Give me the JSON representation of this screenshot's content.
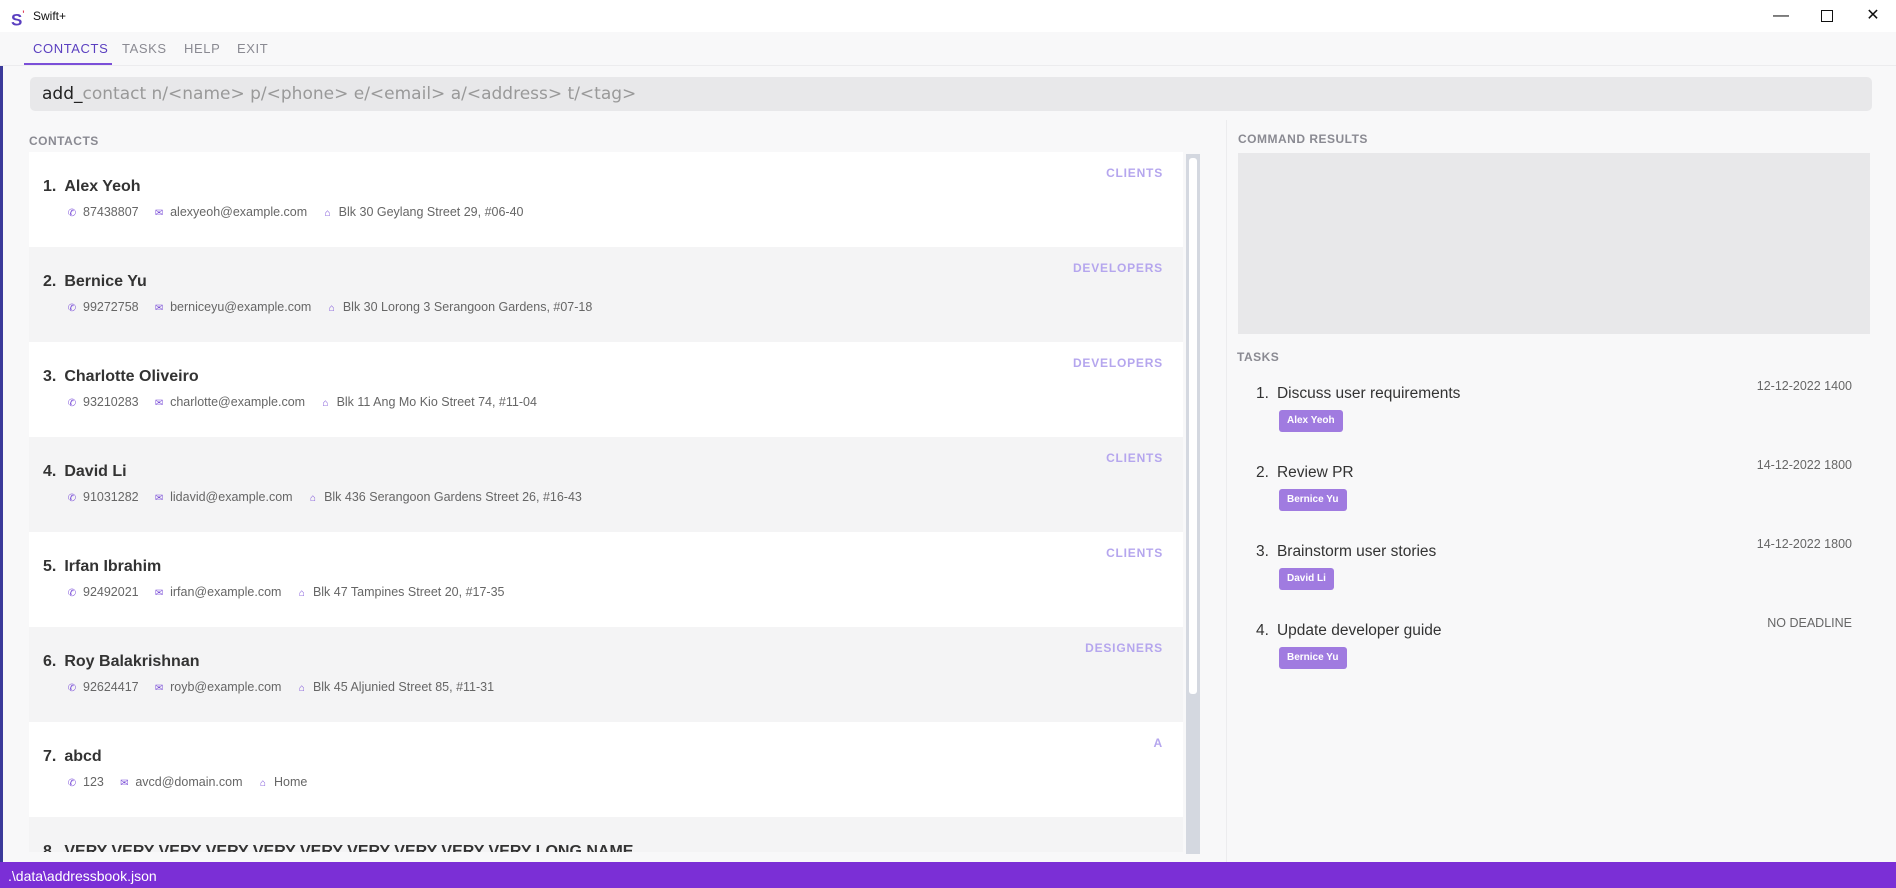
{
  "window": {
    "title": "Swift+",
    "logo": "S",
    "logo_mark": "'"
  },
  "menu": {
    "items": [
      "CONTACTS",
      "TASKS",
      "HELP",
      "EXIT"
    ]
  },
  "command": {
    "typed": "add_",
    "hint": "contact n/<name> p/<phone> e/<email> a/<address> t/<tag>"
  },
  "contacts": {
    "label": "CONTACTS",
    "items": [
      {
        "index": "1.",
        "name": "Alex Yeoh",
        "tag": "CLIENTS",
        "phone": "87438807",
        "email": "alexyeoh@example.com",
        "address": "Blk 30 Geylang Street 29, #06-40"
      },
      {
        "index": "2.",
        "name": "Bernice Yu",
        "tag": "DEVELOPERS",
        "phone": "99272758",
        "email": "berniceyu@example.com",
        "address": "Blk 30 Lorong 3 Serangoon Gardens, #07-18"
      },
      {
        "index": "3.",
        "name": "Charlotte Oliveiro",
        "tag": "DEVELOPERS",
        "phone": "93210283",
        "email": "charlotte@example.com",
        "address": "Blk 11 Ang Mo Kio Street 74, #11-04"
      },
      {
        "index": "4.",
        "name": "David Li",
        "tag": "CLIENTS",
        "phone": "91031282",
        "email": "lidavid@example.com",
        "address": "Blk 436 Serangoon Gardens Street 26, #16-43"
      },
      {
        "index": "5.",
        "name": "Irfan Ibrahim",
        "tag": "CLIENTS",
        "phone": "92492021",
        "email": "irfan@example.com",
        "address": "Blk 47 Tampines Street 20, #17-35"
      },
      {
        "index": "6.",
        "name": "Roy Balakrishnan",
        "tag": "DESIGNERS",
        "phone": "92624417",
        "email": "royb@example.com",
        "address": "Blk 45 Aljunied Street 85, #11-31"
      },
      {
        "index": "7.",
        "name": "abcd",
        "tag": "A",
        "phone": "123",
        "email": "avcd@domain.com",
        "address": "Home"
      },
      {
        "index": "8.",
        "name": "VERY VERY VERY VERY VERY VERY VERY VERY VERY VERY LONG NAME",
        "tag": "",
        "phone": "",
        "email": "",
        "address": ""
      }
    ]
  },
  "results": {
    "label": "COMMAND RESULTS",
    "text": ""
  },
  "tasks": {
    "label": "TASKS",
    "items": [
      {
        "index": "1.",
        "title": "Discuss user requirements",
        "deadline": "12-12-2022 1400",
        "contact": "Alex Yeoh"
      },
      {
        "index": "2.",
        "title": "Review PR",
        "deadline": "14-12-2022 1800",
        "contact": "Bernice Yu"
      },
      {
        "index": "3.",
        "title": "Brainstorm user stories",
        "deadline": "14-12-2022 1800",
        "contact": "David Li"
      },
      {
        "index": "4.",
        "title": "Update developer guide",
        "deadline": "NO DEADLINE",
        "contact": "Bernice Yu"
      }
    ]
  },
  "status": {
    "path": ".\\data\\addressbook.json"
  },
  "colors": {
    "accent": "#7b4fd8",
    "status_bar": "#7b2fd6",
    "tag_text": "#b5a6ee",
    "chip": "#a07be0"
  },
  "icons": {
    "phone": "phone-icon",
    "email": "mail-icon",
    "address": "home-icon"
  }
}
